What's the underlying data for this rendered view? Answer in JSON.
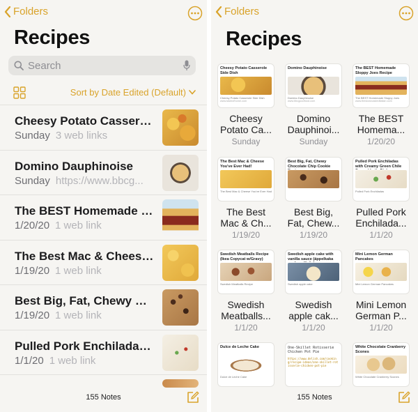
{
  "colors": {
    "accent": "#d9a32a",
    "background": "#f6f5f2"
  },
  "left": {
    "nav": {
      "back_label": "Folders",
      "more_icon": "ellipsis-circle-icon"
    },
    "title": "Recipes",
    "search": {
      "placeholder": "Search",
      "mic_icon": "microphone-icon"
    },
    "toolbar": {
      "view_icon": "gallery-grid-icon",
      "sort_label": "Sort by Date Edited (Default)"
    },
    "notes": [
      {
        "title": "Cheesy Potato Casserol...",
        "date": "Sunday",
        "detail": "3 web links"
      },
      {
        "title": "Domino Dauphinoise",
        "date": "Sunday",
        "detail": "https://www.bbcg..."
      },
      {
        "title": "The BEST Homemade Sl...",
        "date": "1/20/20",
        "detail": "1 web link"
      },
      {
        "title": "The Best Mac & Cheese...",
        "date": "1/19/20",
        "detail": "1 web link"
      },
      {
        "title": "Best Big, Fat, Chewy Ch...",
        "date": "1/19/20",
        "detail": "1 web link"
      },
      {
        "title": "Pulled Pork Enchiladas...",
        "date": "1/1/20",
        "detail": "1 web link"
      }
    ],
    "footer": {
      "count": "155 Notes",
      "compose_icon": "compose-icon"
    }
  },
  "right": {
    "nav": {
      "back_label": "Folders",
      "more_icon": "ellipsis-circle-icon"
    },
    "title": "Recipes",
    "gallery": [
      {
        "card_title": "Cheesy Potato Casserole Side Dish",
        "card_footer": "Cheesy Potato Casserole Side Dish",
        "card_url": "www.tasteofhome.com",
        "line1": "Cheesy",
        "line2": "Potato Ca...",
        "date": "Sunday"
      },
      {
        "card_title": "Domino Dauphinoise",
        "card_footer": "Domino Dauphinoise",
        "card_url": "www.bbcgoodfood.com",
        "line1": "Domino",
        "line2": "Dauphinoi...",
        "date": "Sunday"
      },
      {
        "card_title": "The BEST Homemade Sloppy Joes Recipe",
        "card_footer": "The BEST Homemade Sloppy Joes",
        "card_url": "www.theslowroasteditalian.com",
        "line1": "The BEST",
        "line2": "Homema...",
        "date": "1/20/20"
      },
      {
        "card_title": "The Best Mac & Cheese You've Ever Had!",
        "card_footer": "The Best Mac & Cheese You've Ever Had",
        "card_url": "",
        "line1": "The Best",
        "line2": "Mac & Ch...",
        "date": "1/19/20"
      },
      {
        "card_title": "Best Big, Fat, Chewy Chocolate Chip Cookie Recipe",
        "card_footer": "",
        "card_url": "",
        "line1": "Best Big,",
        "line2": "Fat, Chew...",
        "date": "1/19/20"
      },
      {
        "card_title": "Pulled Pork Enchiladas with Creamy Green Chile Sauce | Let's Dish",
        "card_footer": "Pulled Pork Enchiladas",
        "card_url": "",
        "line1": "Pulled Pork",
        "line2": "Enchilada...",
        "date": "1/1/20"
      },
      {
        "card_title": "Swedish Meatballs Recipe (Ikea Copycat w/Gravy)",
        "card_footer": "Swedish Meatballs Recipe",
        "card_url": "",
        "line1": "Swedish",
        "line2": "Meatballs...",
        "date": "1/1/20"
      },
      {
        "card_title": "Swedish apple cake with vanilla sauce (äppelkaka med vaniljsås)",
        "card_footer": "Swedish apple cake",
        "card_url": "",
        "line1": "Swedish",
        "line2": "apple cak...",
        "date": "1/1/20"
      },
      {
        "card_title": "Mini Lemon German Pancakes",
        "card_footer": "Mini Lemon German Pancakes",
        "card_url": "",
        "line1": "Mini Lemon",
        "line2": "German P...",
        "date": "1/1/20"
      },
      {
        "card_title": "Dulce de Leche Cake",
        "card_footer": "Dulce de Leche Cake",
        "card_url": "",
        "line1": "",
        "line2": "",
        "date": ""
      },
      {
        "card_title": "One-Skillet Rotisserie Chicken Pot Pie",
        "card_footer": "",
        "card_url": "https://www.delish.com/cooking/recipe-ideas/one-skillet-rotisserie-chicken-pot-pie",
        "line1": "",
        "line2": "",
        "date": ""
      },
      {
        "card_title": "White Chocolate Cranberry Scones",
        "card_footer": "White Chocolate Cranberry Scones",
        "card_url": "",
        "line1": "",
        "line2": "",
        "date": ""
      }
    ],
    "footer": {
      "count": "155 Notes",
      "compose_icon": "compose-icon"
    }
  }
}
